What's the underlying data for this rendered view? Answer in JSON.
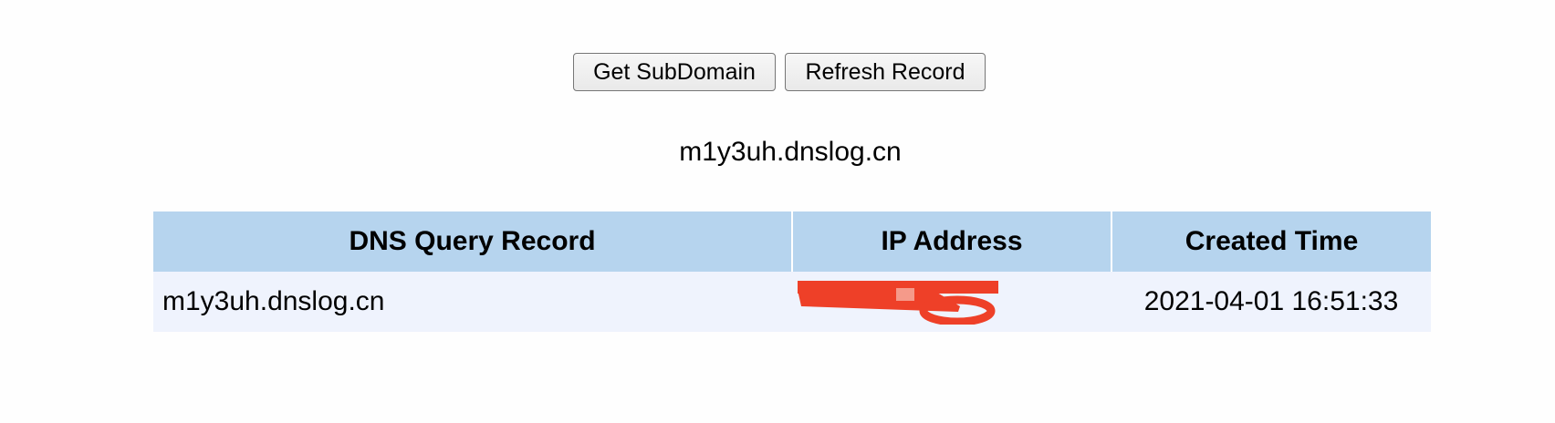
{
  "toolbar": {
    "get_subdomain_label": "Get SubDomain",
    "refresh_record_label": "Refresh Record"
  },
  "subdomain": "m1y3uh.dnslog.cn",
  "table": {
    "headers": [
      "DNS Query Record",
      "IP Address",
      "Created Time"
    ],
    "rows": [
      {
        "query": "m1y3uh.dnslog.cn",
        "ip": "",
        "created": "2021-04-01 16:51:33"
      }
    ]
  },
  "colors": {
    "header_bg": "#b6d4ee",
    "row_bg": "#eff3fd",
    "redaction": "#ee4028"
  }
}
